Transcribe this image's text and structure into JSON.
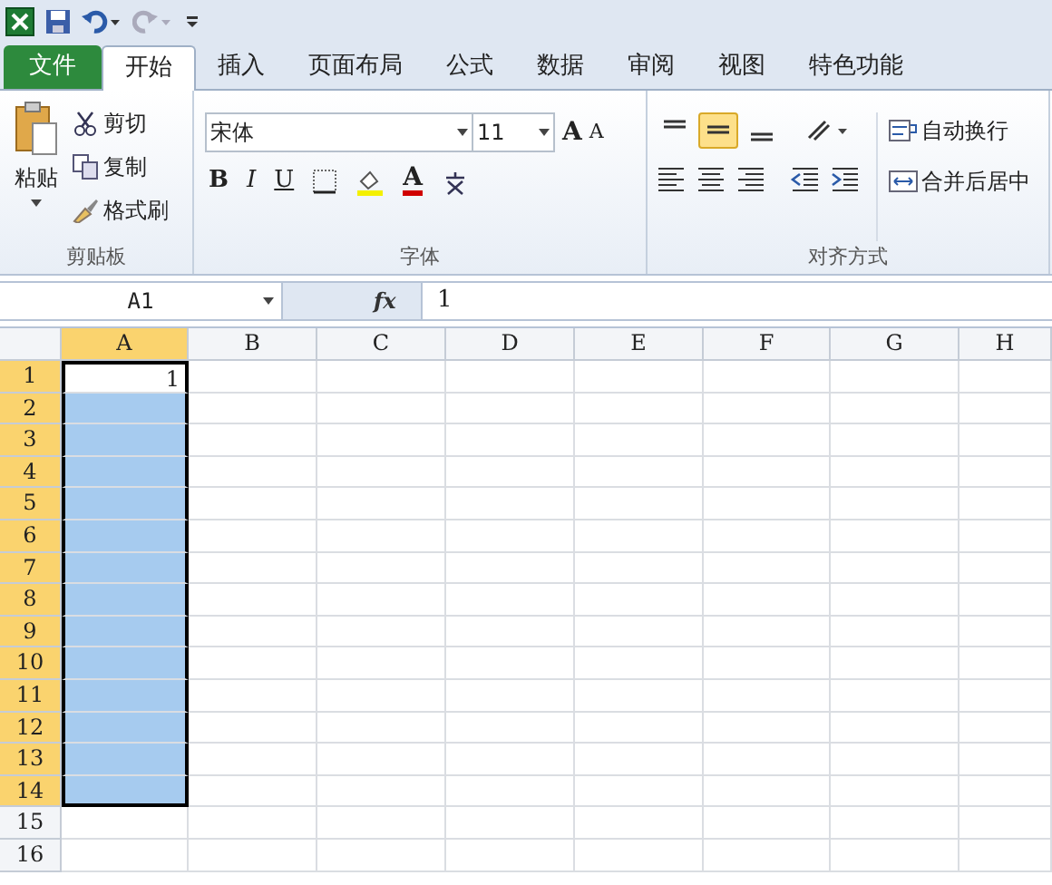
{
  "tabs": [
    {
      "label": "文件",
      "kind": "file",
      "selected": false
    },
    {
      "label": "开始",
      "kind": "tab",
      "selected": true
    },
    {
      "label": "插入",
      "kind": "tab",
      "selected": false
    },
    {
      "label": "页面布局",
      "kind": "tab",
      "selected": false
    },
    {
      "label": "公式",
      "kind": "tab",
      "selected": false
    },
    {
      "label": "数据",
      "kind": "tab",
      "selected": false
    },
    {
      "label": "审阅",
      "kind": "tab",
      "selected": false
    },
    {
      "label": "视图",
      "kind": "tab",
      "selected": false
    },
    {
      "label": "特色功能",
      "kind": "tab",
      "selected": false
    }
  ],
  "clipboard": {
    "paste": "粘贴",
    "cut": "剪切",
    "copy": "复制",
    "format_painter": "格式刷",
    "label": "剪贴板"
  },
  "font": {
    "name": "宋体",
    "size": "11",
    "bold": "B",
    "italic": "I",
    "underline": "U",
    "font_color": "A",
    "grow": "A",
    "shrink": "A",
    "label": "字体"
  },
  "alignment": {
    "vertical": [
      {
        "kind": "top",
        "selected": false
      },
      {
        "kind": "middle",
        "selected": true
      },
      {
        "kind": "bottom",
        "selected": false
      }
    ],
    "wrap": "自动换行",
    "merge": "合并后居中",
    "label": "对齐方式"
  },
  "formula_bar": {
    "name_box": "A1",
    "fx": "fx",
    "value": "1"
  },
  "columns": [
    {
      "label": "A",
      "selected": true
    },
    {
      "label": "B",
      "selected": false
    },
    {
      "label": "C",
      "selected": false
    },
    {
      "label": "D",
      "selected": false
    },
    {
      "label": "E",
      "selected": false
    },
    {
      "label": "F",
      "selected": false
    },
    {
      "label": "G",
      "selected": false
    },
    {
      "label": "H",
      "selected": false
    }
  ],
  "rows": [
    {
      "label": "1",
      "selected": true,
      "cells": [
        "1"
      ]
    },
    {
      "label": "2",
      "selected": true
    },
    {
      "label": "3",
      "selected": true
    },
    {
      "label": "4",
      "selected": true
    },
    {
      "label": "5",
      "selected": true
    },
    {
      "label": "6",
      "selected": true
    },
    {
      "label": "7",
      "selected": true
    },
    {
      "label": "8",
      "selected": true
    },
    {
      "label": "9",
      "selected": true
    },
    {
      "label": "10",
      "selected": true
    },
    {
      "label": "11",
      "selected": true
    },
    {
      "label": "12",
      "selected": true
    },
    {
      "label": "13",
      "selected": true
    },
    {
      "label": "14",
      "selected": true
    },
    {
      "label": "15",
      "selected": false
    },
    {
      "label": "16",
      "selected": false
    }
  ]
}
